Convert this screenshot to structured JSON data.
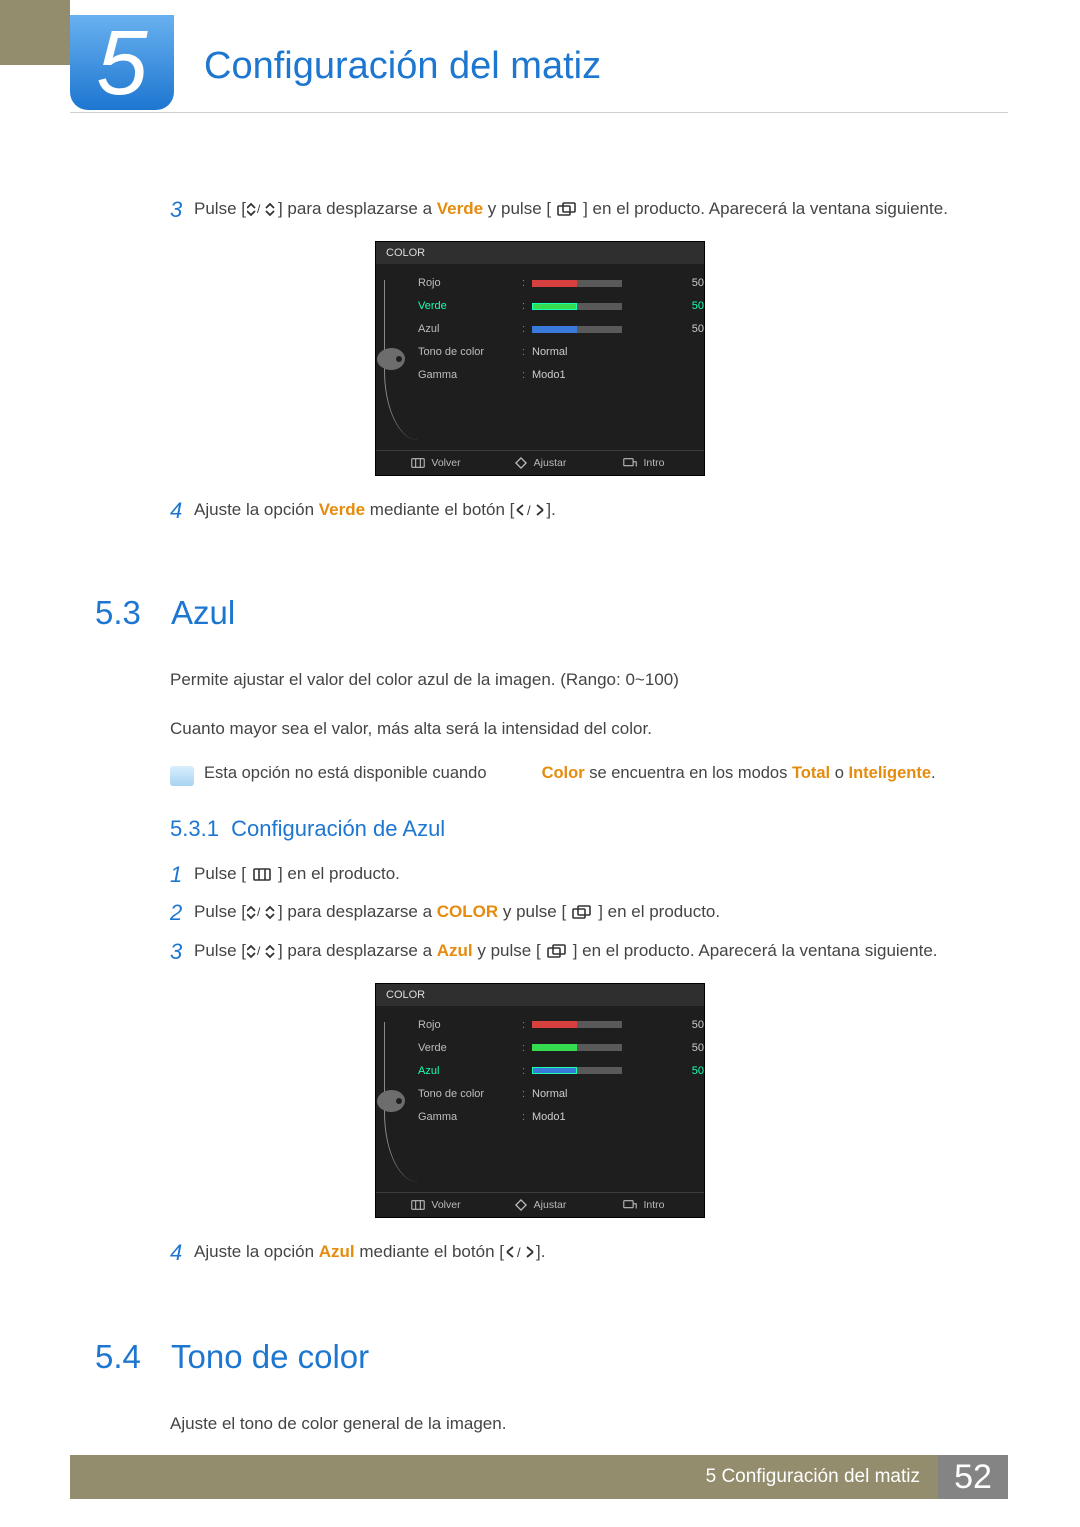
{
  "header": {
    "chapter_number": "5",
    "chapter_title": "Configuración del matiz"
  },
  "block_a": {
    "step3": {
      "num": "3",
      "pre": "Pulse [",
      "mid1": "] para desplazarse a ",
      "word": "Verde",
      "mid2": " y pulse [",
      "tail": "] en el producto. Aparecerá la ventana siguiente."
    },
    "step4": {
      "num": "4",
      "pre": "Ajuste la opción ",
      "word": "Verde",
      "mid": " mediante el botón [",
      "tail": "]."
    }
  },
  "osd1": {
    "title": "COLOR",
    "items": {
      "rojo": {
        "label": "Rojo",
        "value": "50"
      },
      "verde": {
        "label": "Verde",
        "value": "50"
      },
      "azul": {
        "label": "Azul",
        "value": "50"
      },
      "tono": {
        "label": "Tono de color",
        "value": "Normal"
      },
      "gamma": {
        "label": "Gamma",
        "value": "Modo1"
      }
    },
    "footer": {
      "back": "Volver",
      "adjust": "Ajustar",
      "enter": "Intro"
    }
  },
  "section53": {
    "num": "5.3",
    "title": "Azul",
    "p1": "Permite ajustar el valor del color azul de la imagen. (Rango: 0~100)",
    "p2": "Cuanto mayor sea el valor, más alta será la intensidad del color.",
    "note_a": "Esta opción no está disponible cuando ",
    "note_b": "Color",
    "note_c": " se encuentra en los modos ",
    "note_d": "Total",
    "note_e": " o ",
    "note_f": "Inteligente",
    "note_g": ".",
    "sub_num": "5.3.1",
    "sub_title": "Configuración de Azul",
    "s1": {
      "num": "1",
      "pre": "Pulse [",
      "tail": "] en el producto."
    },
    "s2": {
      "num": "2",
      "pre": "Pulse [",
      "mid1": "] para desplazarse a ",
      "word": "COLOR",
      "mid2": " y pulse [",
      "tail": "] en el producto."
    },
    "s3": {
      "num": "3",
      "pre": "Pulse [",
      "mid1": "] para desplazarse a ",
      "word": "Azul",
      "mid2": " y pulse [",
      "tail": "] en el producto. Aparecerá la ventana siguiente."
    },
    "s4": {
      "num": "4",
      "pre": "Ajuste la opción ",
      "word": "Azul",
      "mid": " mediante el botón [",
      "tail": "]."
    }
  },
  "osd2": {
    "title": "COLOR",
    "items": {
      "rojo": {
        "label": "Rojo",
        "value": "50"
      },
      "verde": {
        "label": "Verde",
        "value": "50"
      },
      "azul": {
        "label": "Azul",
        "value": "50"
      },
      "tono": {
        "label": "Tono de color",
        "value": "Normal"
      },
      "gamma": {
        "label": "Gamma",
        "value": "Modo1"
      }
    },
    "footer": {
      "back": "Volver",
      "adjust": "Ajustar",
      "enter": "Intro"
    }
  },
  "section54": {
    "num": "5.4",
    "title": "Tono de color",
    "p1": "Ajuste el tono de color general de la imagen."
  },
  "footer": {
    "text": "5 Configuración del matiz",
    "page": "52"
  }
}
